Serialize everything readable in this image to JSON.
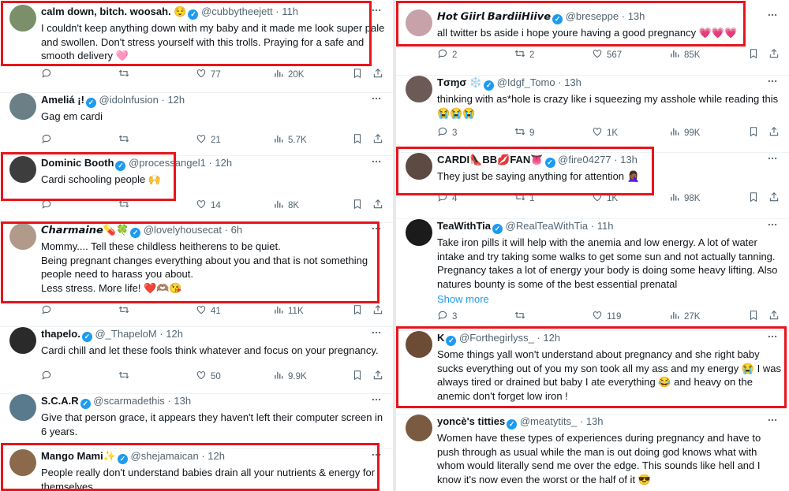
{
  "left": [
    {
      "name": "calm down, bitch. woosah. 😌",
      "handle": "@cubbytheejett",
      "time": "11h",
      "text": "I couldn't keep anything down with my baby and it made me look super pale and swollen. Don't stress yourself with this trolls. Praying for a safe and smooth delivery 🩷",
      "counts": {
        "reply": "",
        "retweet": "",
        "like": "77",
        "views": "20K"
      },
      "avatar": "#7a8f6a"
    },
    {
      "name": "Ameliá ¡!",
      "handle": "@idolnfusion",
      "time": "12h",
      "text": "Gag em cardi",
      "counts": {
        "reply": "",
        "retweet": "",
        "like": "21",
        "views": "5.7K"
      },
      "avatar": "#6b7f86"
    },
    {
      "name": "Dominic Booth",
      "handle": "@processangel1",
      "time": "12h",
      "text": "Cardi schooling people 🙌",
      "counts": {
        "reply": "",
        "retweet": "",
        "like": "14",
        "views": "8K"
      },
      "avatar": "#3d3d3d"
    },
    {
      "name": "𝘾𝙝𝙖𝙧𝙢𝙖𝙞𝙣𝙚💊🍀",
      "handle": "@lovelyhousecat",
      "time": "6h",
      "text": "Mommy.... Tell these childless heitherens to be quiet.\nBeing pregnant changes everything about you and that is not something people need to harass you about.\nLess stress. More life! ❤️🫶🏽😘",
      "counts": {
        "reply": "",
        "retweet": "",
        "like": "41",
        "views": "11K"
      },
      "avatar": "#b29a8a"
    },
    {
      "name": "thapelo.",
      "handle": "@_ThapeloM",
      "time": "12h",
      "text": "Cardi chill and let these fools think whatever and focus on your pregnancy.",
      "counts": {
        "reply": "",
        "retweet": "",
        "like": "50",
        "views": "9.9K"
      },
      "avatar": "#2a2a2a"
    },
    {
      "name": "S.C.A.R",
      "handle": "@scarmadethis",
      "time": "13h",
      "text": "Give that person grace, it appears they haven't left their computer screen in 6 years.",
      "counts": {
        "reply": "",
        "retweet": "",
        "like": "",
        "views": ""
      },
      "avatar": "#587a8c"
    },
    {
      "name": "Mango Mami✨",
      "handle": "@shejamaican",
      "time": "12h",
      "text": "People really don't understand babies drain all your nutrients & energy for themselves.",
      "counts": {
        "reply": "",
        "retweet": "",
        "like": "",
        "views": ""
      },
      "avatar": "#8a6a4a"
    }
  ],
  "right": [
    {
      "name": "𝙃𝙤𝙩 𝙂𝙞𝙞𝙧𝙡 𝘽𝙖𝙧𝙙𝙞𝙞𝙃𝙞𝙞𝙫𝙚",
      "handle": "@breseppe",
      "time": "13h",
      "text": "all twitter bs aside i hope youre having a good pregnancy 💗💗💗",
      "counts": {
        "reply": "2",
        "retweet": "2",
        "like": "567",
        "views": "85K"
      },
      "avatar": "#c7a2a9"
    },
    {
      "name": "Tσɱσ ❄️",
      "handle": "@Idgf_Tomo",
      "time": "13h",
      "text": "thinking with as*hole is crazy like i squeezing my asshole while reading this 😭😭😭",
      "counts": {
        "reply": "3",
        "retweet": "9",
        "like": "1K",
        "views": "99K"
      },
      "avatar": "#6b5a55"
    },
    {
      "name": "CARDI👠BB💋FAN👅",
      "handle": "@fire04277",
      "time": "13h",
      "text": "They just be saying anything for attention 🤦🏾‍♀️",
      "counts": {
        "reply": "4",
        "retweet": "1",
        "like": "1K",
        "views": "98K"
      },
      "avatar": "#5d4a43"
    },
    {
      "name": "TeaWithTia",
      "handle": "@RealTeaWithTia",
      "time": "11h",
      "text": "Take iron pills it will help with the anemia and low energy. A lot of water intake and try taking some walks to get some sun and not actually tanning. Pregnancy takes a lot of energy your body is doing some heavy lifting. Also natures bounty is some of the best essential prenatal",
      "show_more": "Show more",
      "counts": {
        "reply": "3",
        "retweet": "",
        "like": "119",
        "views": "27K"
      },
      "avatar": "#1b1b1b"
    },
    {
      "name": "K",
      "handle": "@Forthegirlyss_",
      "time": "12h",
      "text": "Some things yall won't understand about pregnancy and she right baby sucks everything out of you my son took all my ass and my energy 😭 I was always tired or drained but baby I ate everything 😂 and heavy on the anemic don't forget low iron !",
      "counts": {
        "reply": "",
        "retweet": "",
        "like": "",
        "views": ""
      },
      "avatar": "#6e4b35"
    },
    {
      "name": "yoncè's titties",
      "handle": "@meatytits_",
      "time": "13h",
      "text": "Women have these types of experiences during pregnancy and have to push through as usual while the man is out doing god knows what with whom would literally send me over the edge. This sounds like hell and I know it's now even the worst or the half of it 😎",
      "counts": {
        "reply": "",
        "retweet": "",
        "like": "",
        "views": ""
      },
      "avatar": "#7a5a40"
    }
  ],
  "icons": {
    "more": "more-options-icon",
    "reply": "reply-icon",
    "retweet": "retweet-icon",
    "like": "like-icon",
    "views": "views-icon",
    "bookmark": "bookmark-icon",
    "share": "share-icon",
    "verified": "verified-badge-icon"
  },
  "colors": {
    "highlight": "#e8141b",
    "verified": "#1d9bf0",
    "muted": "#536471",
    "link": "#1d9bf0"
  }
}
